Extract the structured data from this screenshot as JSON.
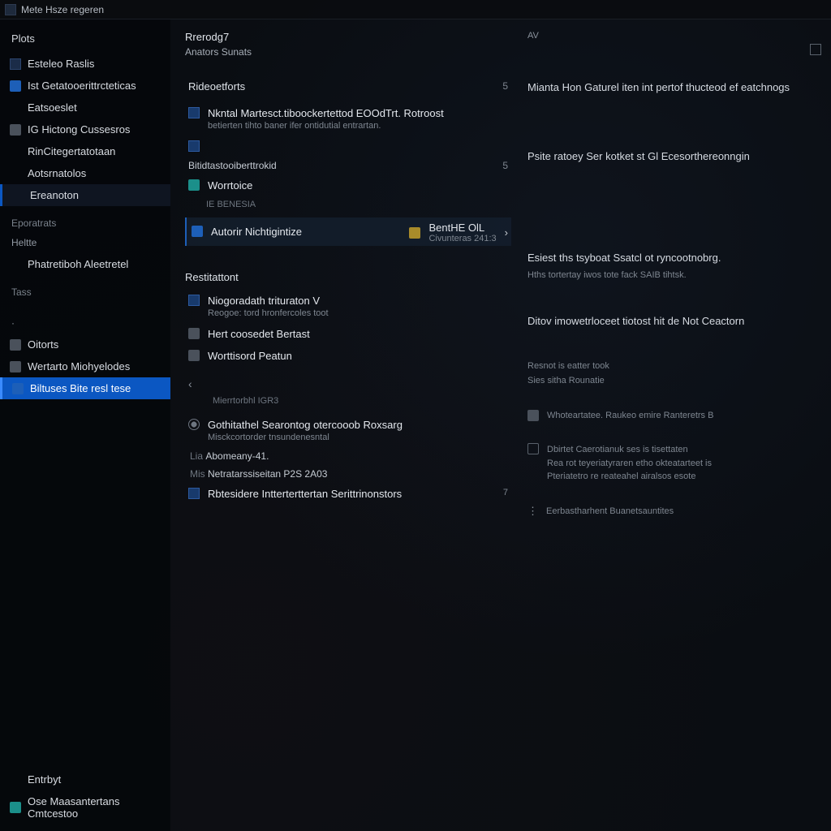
{
  "titlebar": {
    "title": "Mete Hsze regeren"
  },
  "sidebar": {
    "header": "Plots",
    "items": [
      {
        "label": "Esteleo Raslis",
        "icon": "box"
      },
      {
        "label": "Ist Getatooerittrcteticas",
        "icon": "blue"
      },
      {
        "label": "Eatsoeslet",
        "icon": ""
      },
      {
        "label": "IG Hictong Cussesros",
        "icon": "gray"
      },
      {
        "label": "RinCitegertatotaan",
        "icon": ""
      },
      {
        "label": "Aotsrnatolos",
        "icon": ""
      },
      {
        "label": "Ereanoton",
        "icon": "",
        "active": true
      }
    ],
    "cat_exports": "Eporatrats",
    "exports": [
      {
        "label": "Heltte",
        "dim": true
      },
      {
        "label": "Phatretiboh Aleetretel",
        "icon": ""
      }
    ],
    "cat_tags": "Tass",
    "cat_other": [
      {
        "label": "Oitorts",
        "icon": "gray"
      },
      {
        "label": "Wertarto Miohyelodes",
        "icon": "gray"
      },
      {
        "label": "Biltuses Bite resl tese",
        "icon": "blue",
        "selected": true
      }
    ],
    "bottom": [
      {
        "label": "Entrbyt",
        "icon": ""
      },
      {
        "label": "Ose Maasantertans Cmtcestoo",
        "icon": "teal"
      }
    ]
  },
  "center": {
    "heading": "Rrerodg7",
    "subheading": "Anators Sunats",
    "sec_records": "Rideoetforts",
    "records_tag": "5",
    "rec1": {
      "title": "Nkntal Martesct.tiboockertettod EOOdTrt.  Rotroost",
      "desc": "betierten tihto baner ifer ontidutial entrartan."
    },
    "rec2_icon_only": true,
    "row_eff": {
      "label": "Bitidtastooiberttrokid",
      "val": "5"
    },
    "sec_wort": {
      "title": "Worrtoice",
      "sub": "IE BENESIA"
    },
    "sel_item": {
      "title": "Autorir Nichtigintize",
      "side_label": "BentHE OlL",
      "side_sub": "Civunteras 241:3"
    },
    "sec_rest": "Restitattont",
    "rest1": {
      "title": "Niogoradath trituraton V",
      "desc": "Reogoe: tord hronfercoles toot"
    },
    "rest2": {
      "title": "Hert coosedet Bertast"
    },
    "rest3": {
      "title": "Worttisord Peatun"
    },
    "sec_more": {
      "back": "‹",
      "line1": "Mierrtorbhl IGR3",
      "line2_title": "Gothitathel Searontog otercooob Roxsarg",
      "line2_desc": "Misckcortorder tnsundenesntal",
      "line3_pre": "Lia",
      "line3": "Abomeany-41.",
      "line4_pre": "Mis",
      "line4": "Netratarssiseitan P2S 2A03",
      "line5": "Rbtesidere Intterterttertan Serittrinonstors",
      "line5_val": "7"
    }
  },
  "right": {
    "top_tag": "AV",
    "blk1": "Mianta Hon Gaturel iten int pertof thucteod ef eatchnogs",
    "blk2": "Psite ratoey Ser kotket st Gl Ecesorthereonngin",
    "blk3_title": "Esiest ths tsyboat Ssatcl ot ryncootnobrg.",
    "blk3_sub": "Hths tortertay iwos tote fack SAIB tihtsk.",
    "blk4": "Ditov imowetrloceet tiotost hit de Not Ceactorn",
    "blk5_title": "Resnot is eatter took",
    "blk5_sub": "Sies sitha Rounatie",
    "blk6": "Whoteartatee. Raukeo emire Ranteretrs B",
    "blk7_title": "Dbirtet Caerotianuk ses is tisettaten",
    "blk7_sub1": "Rea rot teyeriatyraren etho okteatarteet is",
    "blk7_sub2": "Pteriatetro re reateahel airalsos esote",
    "blk8": "Eerbastharhent Buanetsauntites"
  }
}
